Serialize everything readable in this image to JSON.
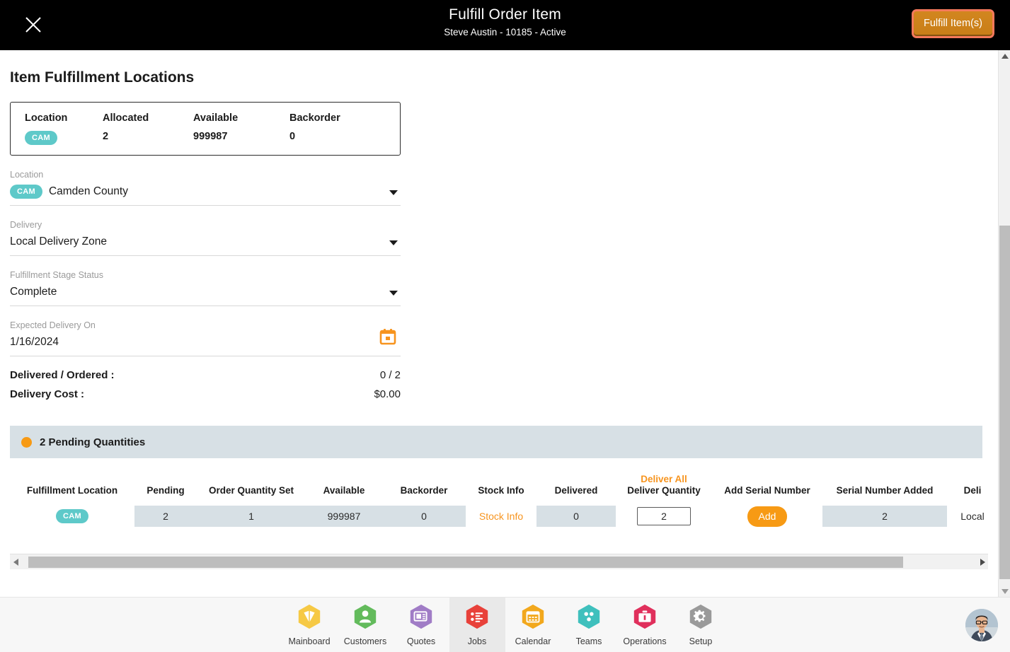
{
  "header": {
    "title": "Fulfill Order Item",
    "subtitle": "Steve Austin - 10185 - Active",
    "close_label": "×",
    "fulfill_button": "Fulfill Item(s)",
    "accent_border": "#f4795b",
    "accent_fill": "#c87e18"
  },
  "page": {
    "title": "Item Fulfillment Locations"
  },
  "summary": {
    "headers": [
      "Location",
      "Allocated",
      "Available",
      "Backorder"
    ],
    "row": {
      "location_badge": "CAM",
      "allocated": "2",
      "available": "999987",
      "backorder": "0"
    },
    "badge_color": "#5ec9c9"
  },
  "fields": [
    {
      "label": "Location",
      "badge": "CAM",
      "value": "Camden County",
      "type": "select"
    },
    {
      "label": "Delivery",
      "badge": "",
      "value": "Local Delivery Zone",
      "type": "select"
    },
    {
      "label": "Fulfillment Stage Status",
      "badge": "",
      "value": "Complete",
      "type": "select"
    },
    {
      "label": "Expected Delivery On",
      "badge": "",
      "value": "1/16/2024",
      "type": "date"
    }
  ],
  "totals": [
    {
      "label": "Delivered / Ordered :",
      "value": "0 / 2"
    },
    {
      "label": "Delivery Cost :",
      "value": "$0.00"
    }
  ],
  "pending_banner": {
    "text": "2 Pending Quantities",
    "dot_color": "#f79a14",
    "background": "#d7e0e5"
  },
  "table": {
    "headers": [
      "Fulfillment Location",
      "Pending",
      "Order Quantity Set",
      "Available",
      "Backorder",
      "Stock Info",
      "Delivered",
      "Deliver Quantity",
      "Add Serial Number",
      "Serial Number Added",
      "Deli"
    ],
    "deliver_all_link": "Deliver All",
    "rows": [
      {
        "location_badge": "CAM",
        "pending": "2",
        "order_quantity_set": "1",
        "available": "999987",
        "backorder": "0",
        "stock_info": "Stock Info",
        "delivered": "0",
        "deliver_quantity": "2",
        "add_serial_button": "Add",
        "serial_number_added": "2",
        "delivery": "Local"
      }
    ],
    "cell_background": "#d7e0e5",
    "link_color": "#f7941e"
  },
  "bottom_nav": {
    "items": [
      {
        "label": "Mainboard",
        "icon": "mainboard-icon",
        "color": "#f6c945",
        "active": false
      },
      {
        "label": "Customers",
        "icon": "person-icon",
        "color": "#63bb5c",
        "active": false
      },
      {
        "label": "Quotes",
        "icon": "quotes-icon",
        "color": "#a07cc6",
        "active": false
      },
      {
        "label": "Jobs",
        "icon": "jobs-list-icon",
        "color": "#e8413a",
        "active": true
      },
      {
        "label": "Calendar",
        "icon": "calendar-icon",
        "color": "#f2a81d",
        "active": false
      },
      {
        "label": "Teams",
        "icon": "teams-icon",
        "color": "#3fc0bd",
        "active": false
      },
      {
        "label": "Operations",
        "icon": "briefcase-icon",
        "color": "#e0305c",
        "active": false
      },
      {
        "label": "Setup",
        "icon": "gear-icon",
        "color": "#9a9a9a",
        "active": false
      }
    ]
  },
  "scrollbars": {
    "horizontal_left_arrow": "◀",
    "horizontal_right_arrow": "▶",
    "vertical_up_arrow": "▲",
    "vertical_down_arrow": "▼"
  }
}
